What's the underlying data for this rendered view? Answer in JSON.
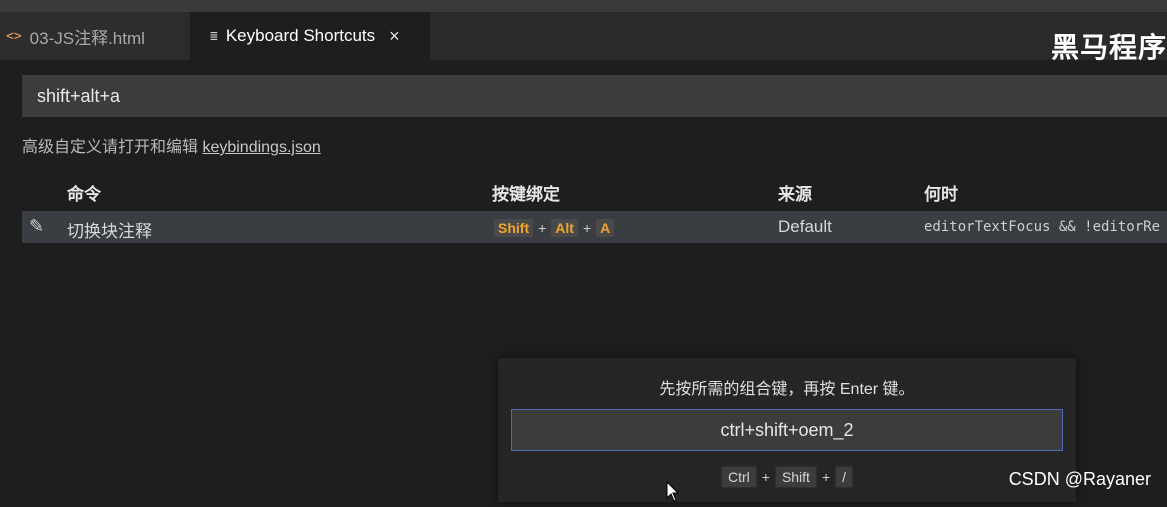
{
  "tabs": [
    {
      "label": "03-JS注释.html",
      "icon": "code-file-icon",
      "active": false
    },
    {
      "label": "Keyboard Shortcuts",
      "icon": "lines-icon",
      "active": true,
      "close": "×"
    }
  ],
  "brand": "黑马程序",
  "search": {
    "value": "shift+alt+a"
  },
  "hint": {
    "text": "高级自定义请打开和编辑 ",
    "link": "keybindings.json"
  },
  "table": {
    "headers": [
      "命令",
      "按键绑定",
      "来源",
      "何时"
    ],
    "rows": [
      {
        "command": "切换块注释",
        "keys": [
          "Shift",
          "Alt",
          "A"
        ],
        "source": "Default",
        "when": "editorTextFocus && !editorRe"
      }
    ]
  },
  "capture": {
    "message": "先按所需的组合键，再按 Enter 键。",
    "value": "ctrl+shift+oem_2",
    "keys": [
      "Ctrl",
      "Shift",
      "/"
    ]
  },
  "watermark": "CSDN @Rayaner",
  "colors": {
    "keyHighlight": "#f0a530",
    "inputBorder": "#4d6bb3",
    "rowSelected": "#3a3d41"
  }
}
